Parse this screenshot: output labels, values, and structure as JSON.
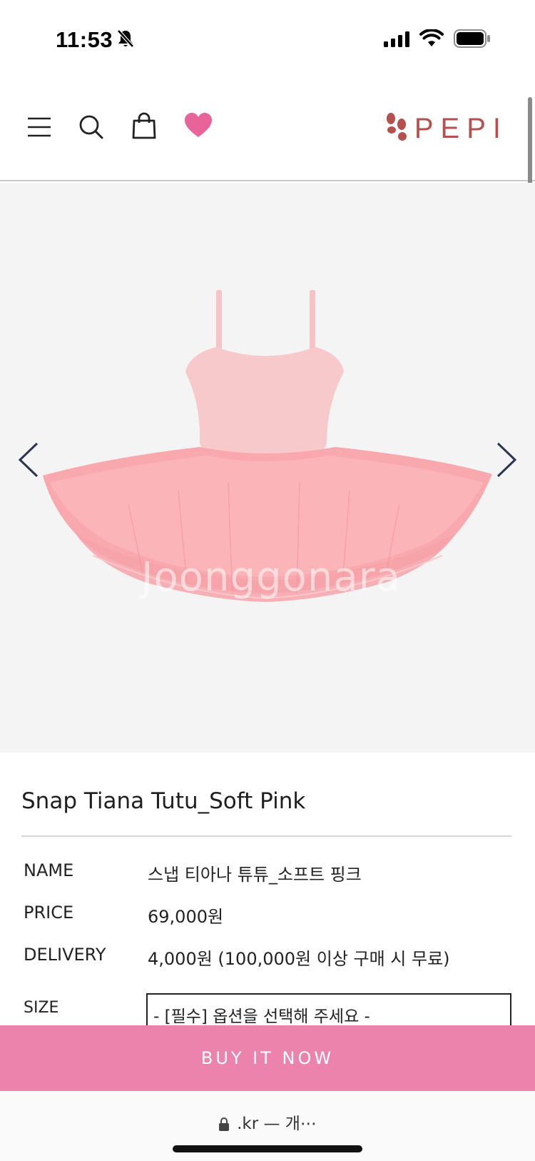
{
  "status_bar": {
    "time": "11:53",
    "icons": [
      "bell-off-icon",
      "signal-icon",
      "wifi-icon",
      "battery-icon"
    ]
  },
  "header": {
    "icons": [
      "menu-icon",
      "search-icon",
      "bag-icon",
      "heart-icon"
    ],
    "logo_text": "PEPI",
    "colors": {
      "logo": "#b5504f",
      "heart": "#e8639a"
    }
  },
  "gallery": {
    "watermark": "Joonggonara",
    "prev_icon": "chevron-left-icon",
    "next_icon": "chevron-right-icon"
  },
  "product": {
    "title": "Snap Tiana Tutu_Soft Pink",
    "name_label": "NAME",
    "name_value": "스냅 티아나 튜튜_소프트 핑크",
    "price_label": "PRICE",
    "price_value": "69,000원",
    "delivery_label": "DELIVERY",
    "delivery_value": "4,000원 (100,000원 이상 구매 시 무료)",
    "size_label": "SIZE",
    "size_select_value": "- [필수] 옵션을 선택해 주세요 -"
  },
  "buy_bar": {
    "label": "BUY IT NOW",
    "color": "#ec83ac"
  },
  "url_bar": {
    "url_text": ".kr — 개⋯"
  }
}
